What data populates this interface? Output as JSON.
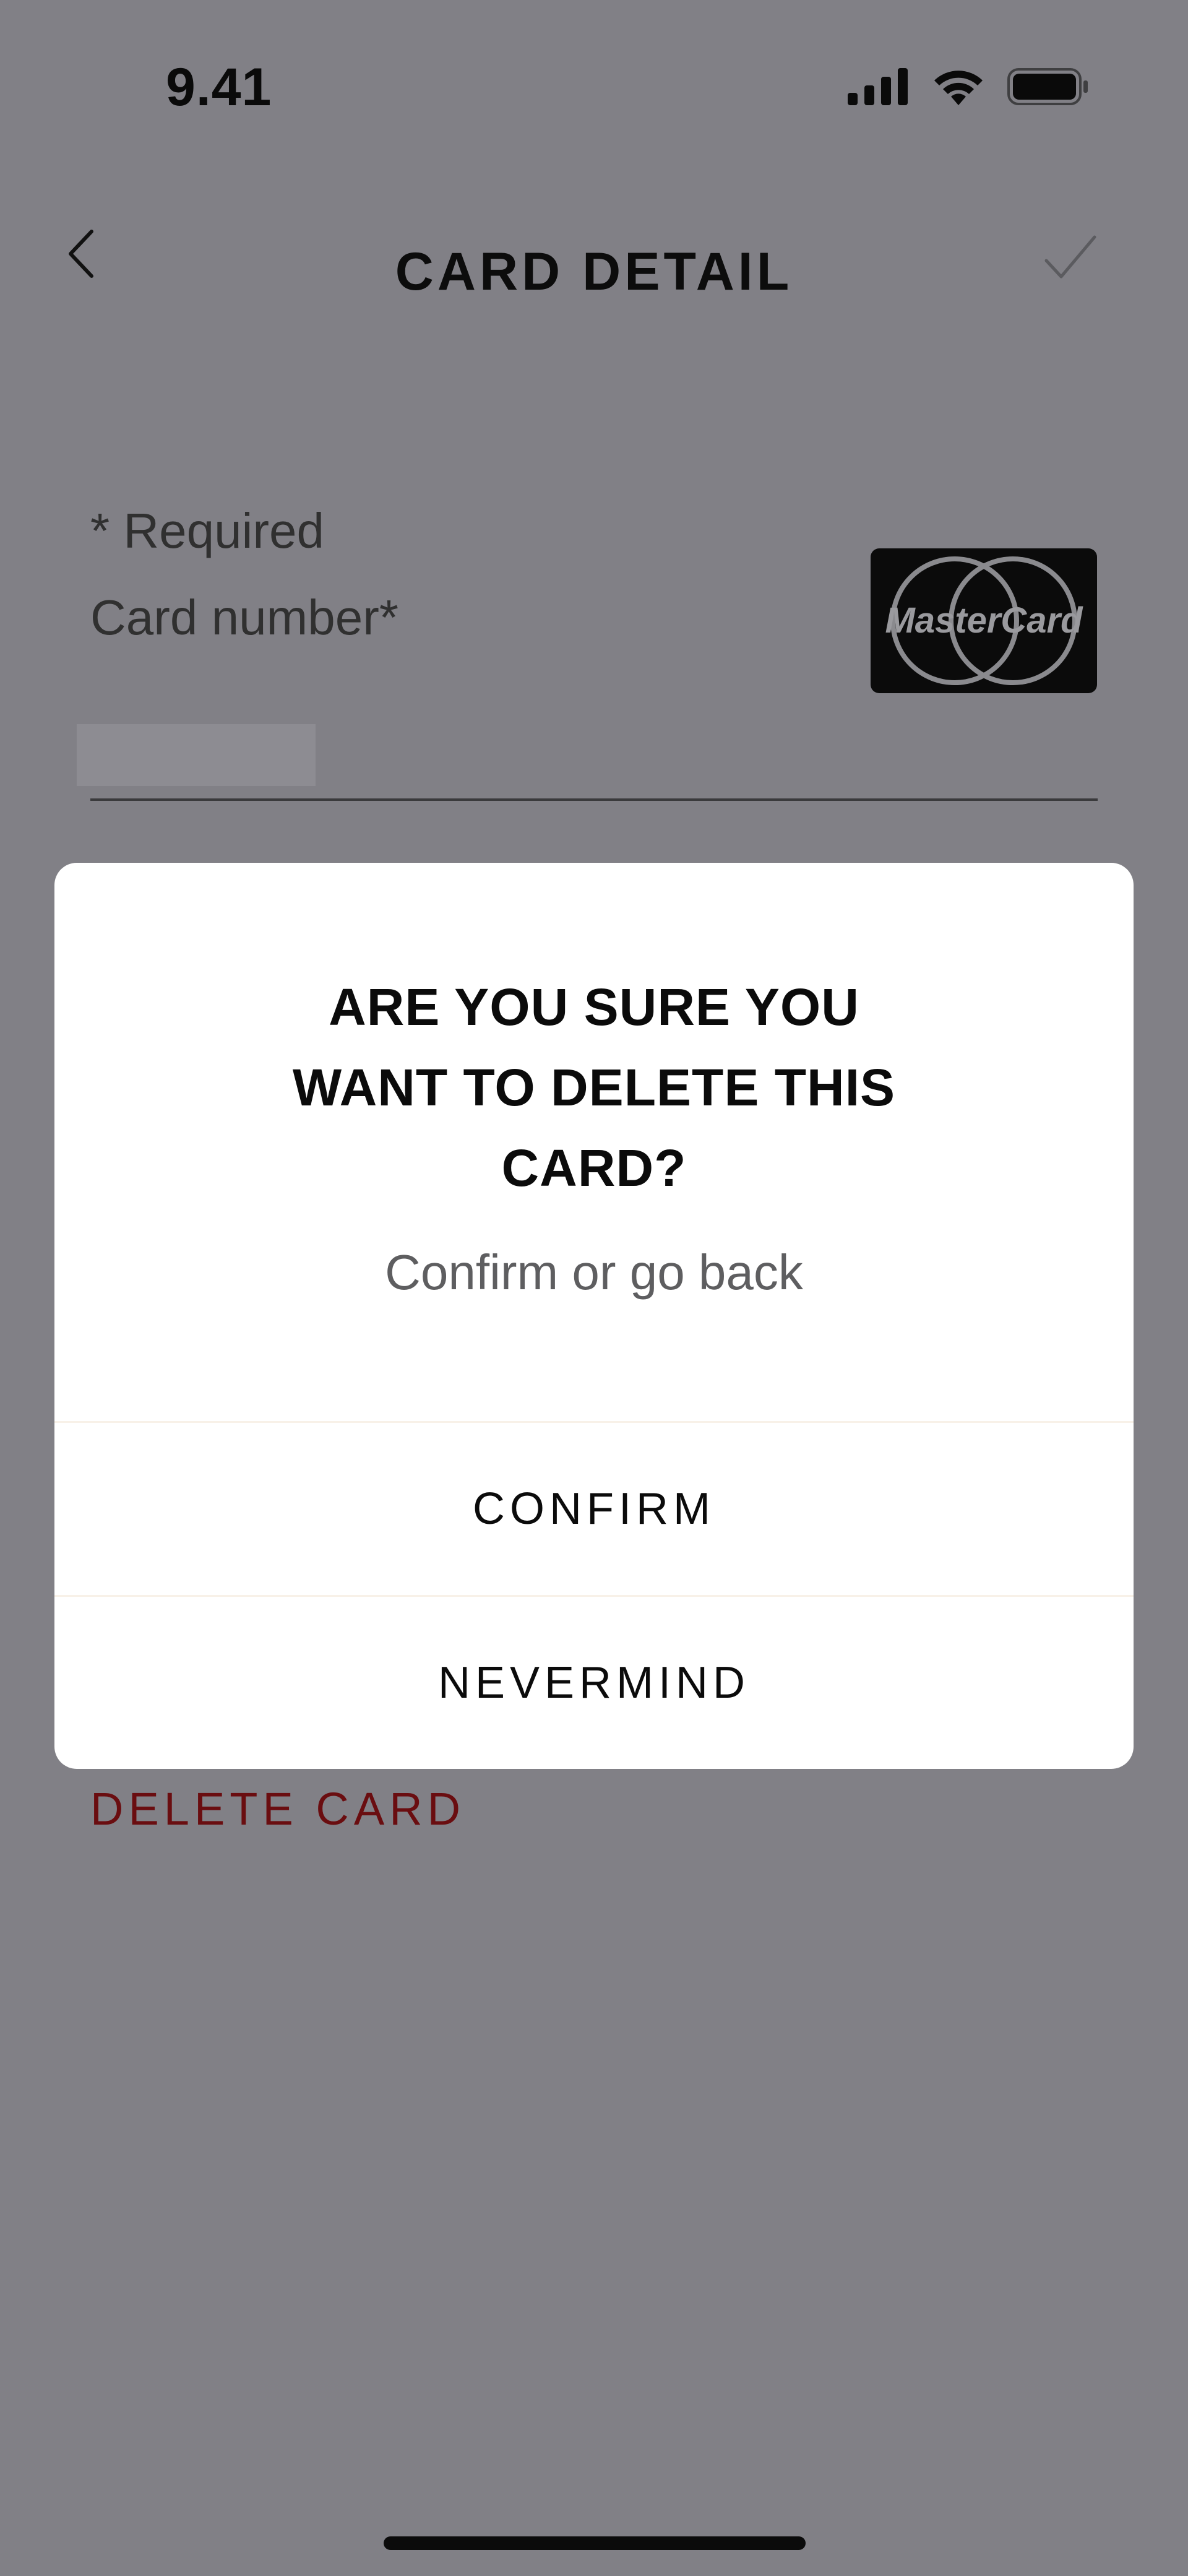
{
  "status_bar": {
    "time": "9.41"
  },
  "nav": {
    "title": "CARD DETAIL",
    "back_icon": "chevron-left-icon",
    "confirm_icon": "checkmark-icon"
  },
  "form": {
    "required_note": "* Required",
    "card_number_label": "Card number*",
    "card_brand": "MasterCard",
    "delete_label": "DELETE CARD"
  },
  "dialog": {
    "title": "ARE YOU SURE YOU\nWANT TO DELETE THIS\nCARD?",
    "subtitle": "Confirm or go back",
    "confirm_label": "CONFIRM",
    "cancel_label": "NEVERMIND"
  },
  "colors": {
    "overlay_background": "#818086",
    "dialog_background": "#ffffff",
    "destructive": "#6a0d10",
    "text_primary": "#0b0b0b",
    "text_secondary": "#5e5e60"
  }
}
